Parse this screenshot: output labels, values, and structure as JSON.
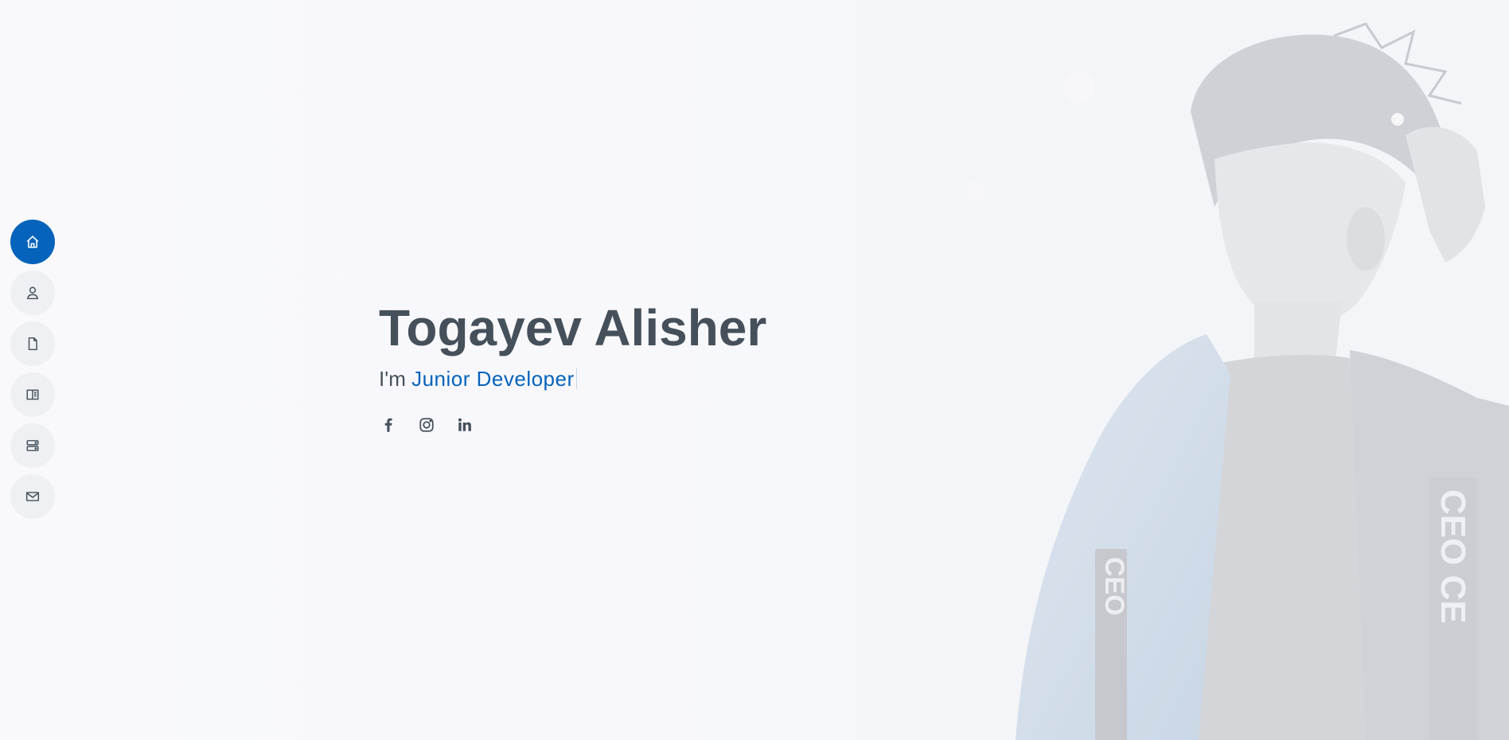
{
  "hero": {
    "name": "Togayev Alisher",
    "role_prefix": "I'm ",
    "role_typed": "Junior Developer"
  },
  "sidenav": {
    "items": [
      {
        "label": "Home",
        "icon": "house-icon",
        "active": true
      },
      {
        "label": "About",
        "icon": "person-icon",
        "active": false
      },
      {
        "label": "Resume",
        "icon": "file-icon",
        "active": false
      },
      {
        "label": "Portfolio",
        "icon": "book-half-icon",
        "active": false
      },
      {
        "label": "Services",
        "icon": "server-icon",
        "active": false
      },
      {
        "label": "Contact",
        "icon": "envelope-icon",
        "active": false
      }
    ]
  },
  "social": [
    {
      "name": "facebook",
      "icon": "facebook-icon"
    },
    {
      "name": "instagram",
      "icon": "instagram-icon"
    },
    {
      "name": "linkedin",
      "icon": "linkedin-icon"
    }
  ],
  "colors": {
    "accent": "#0563bb",
    "text": "#45505b",
    "nav_bg": "#eef0f3",
    "page_bg": "#f8f8fb"
  }
}
